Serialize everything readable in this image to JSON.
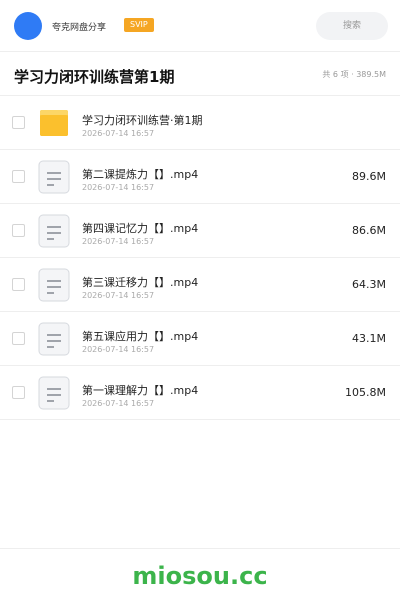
{
  "header": {
    "user_name": "夸克网盘分享",
    "badge": "SVIP",
    "search_placeholder": "搜索",
    "avatar_color": "#2f7bf5",
    "badge_color": "#f5a623"
  },
  "folder": {
    "title": "学习力闭环训练营第1期",
    "meta": "共 6 项 · 389.5M"
  },
  "files": [
    {
      "name": "学习力闭环训练营·第1期",
      "date": "2026-07-14 16:57",
      "size": "",
      "icon": "folder-icon"
    },
    {
      "name": "第二课提炼力【】.mp4",
      "date": "2026-07-14 16:57",
      "size": "89.6M",
      "icon": "document-icon"
    },
    {
      "name": "第四课记忆力【】.mp4",
      "date": "2026-07-14 16:57",
      "size": "86.6M",
      "icon": "document-icon"
    },
    {
      "name": "第三课迁移力【】.mp4",
      "date": "2026-07-14 16:57",
      "size": "64.3M",
      "icon": "document-icon"
    },
    {
      "name": "第五课应用力【】.mp4",
      "date": "2026-07-14 16:57",
      "size": "43.1M",
      "icon": "document-icon"
    },
    {
      "name": "第一课理解力【】.mp4",
      "date": "2026-07-14 16:57",
      "size": "105.8M",
      "icon": "document-icon"
    }
  ],
  "watermark": "miosou.cc",
  "colors": {
    "folder": "#fbc02d",
    "watermark": "#3cb44b"
  }
}
